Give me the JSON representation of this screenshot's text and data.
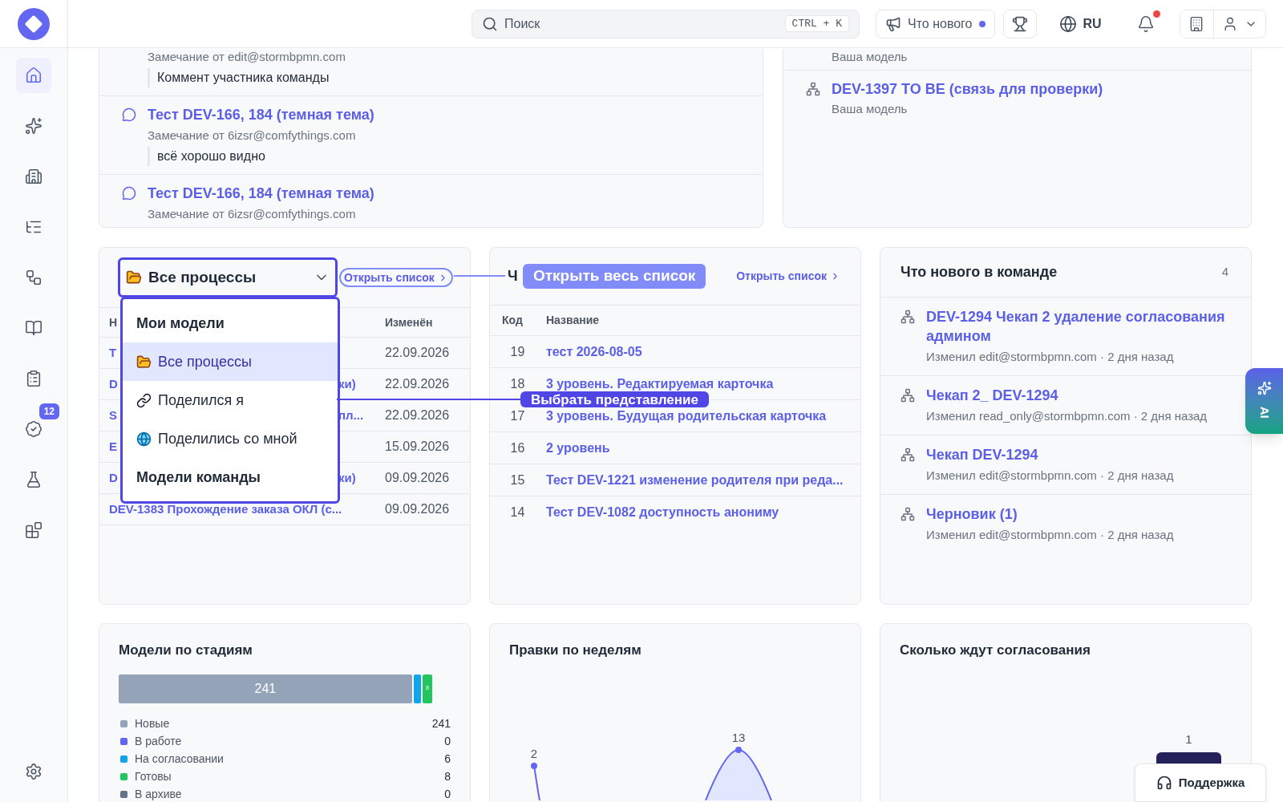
{
  "sidebar": {
    "nav": [
      {
        "selected": true
      },
      {
        "selected": false
      },
      {
        "selected": false
      },
      {
        "selected": false
      },
      {
        "selected": false
      },
      {
        "selected": false
      },
      {
        "selected": false
      },
      {
        "selected": false,
        "badge": "12"
      },
      {
        "selected": false
      },
      {
        "selected": false
      }
    ]
  },
  "header": {
    "search": {
      "placeholder": "Поиск",
      "shortcut": "CTRL + K"
    },
    "whats_new": {
      "label": "Что нового",
      "unread": true
    },
    "language": "RU",
    "notifications": {
      "unread": true
    }
  },
  "comments_card": {
    "items": [
      {
        "meta": "Замечание от edit@stormbpmn.com",
        "quote": "Коммент участника команды"
      },
      {
        "title": "Тест DEV-166, 184 (темная тема)",
        "meta": "Замечание от 6izsr@comfythings.com",
        "quote": "всё хорошо видно"
      },
      {
        "title": "Тест DEV-166, 184 (темная тема)",
        "meta": "Замечание от 6izsr@comfythings.com"
      }
    ]
  },
  "models_card": {
    "items": [
      {
        "subtitle": "Ваша модель"
      },
      {
        "title": "DEV-1397 TO BE (связь для проверки)",
        "subtitle": "Ваша модель"
      }
    ]
  },
  "processes_card": {
    "view_select": {
      "value": "Все процессы"
    },
    "open_link": "Открыть список",
    "columns": [
      "Н",
      "Изменён"
    ],
    "rows": [
      {
        "name": "Т",
        "modified": "22.09.2026"
      },
      {
        "name": "D",
        "name_tail": "ки)",
        "modified": "22.09.2026"
      },
      {
        "name": "S",
        "name_tail": "пл...",
        "modified": "22.09.2026"
      },
      {
        "name": "E",
        "modified": "15.09.2026"
      },
      {
        "name": "D",
        "name_tail": "ки)",
        "modified": "09.09.2026"
      },
      {
        "name": "DEV-1383 Прохождение заказа ОКЛ (с...",
        "modified": "09.09.2026"
      }
    ],
    "menu": [
      {
        "kind": "heading",
        "label": "Мои модели",
        "selected": false
      },
      {
        "kind": "option",
        "label": "Все процессы",
        "selected": true
      },
      {
        "kind": "option",
        "label": "Поделился я",
        "selected": false
      },
      {
        "kind": "option",
        "label": "Поделились со мной",
        "selected": false
      },
      {
        "kind": "heading",
        "label": "Модели команды",
        "selected": false
      }
    ]
  },
  "changes_card": {
    "title": "Ч",
    "open_link": "Открыть список",
    "columns": [
      "Код",
      "Название"
    ],
    "rows": [
      {
        "code": "19",
        "name": "тест 2026-08-05"
      },
      {
        "code": "18",
        "name": "3 уровень. Редактируемая карточка"
      },
      {
        "code": "17",
        "name": "3 уровень. Будущая родительская карточка"
      },
      {
        "code": "16",
        "name": "2 уровень"
      },
      {
        "code": "15",
        "name": "Тест DEV-1221 изменение родителя при реда..."
      },
      {
        "code": "14",
        "name": "Тест DEV-1082 доступность анониму"
      }
    ]
  },
  "team_news": {
    "title": "Что нового в команде",
    "count": "4",
    "items": [
      {
        "title": "DEV-1294 Чекап 2 удаление согласования админом",
        "meta": "Изменил edit@stormbpmn.com · 2 дня назад"
      },
      {
        "title": "Чекап 2_ DEV-1294",
        "meta": "Изменил read_only@stormbpmn.com · 2 дня назад"
      },
      {
        "title": "Чекап DEV-1294",
        "meta": "Изменил edit@stormbpmn.com · 2 дня назад"
      },
      {
        "title": "Черновик (1)",
        "meta": "Изменил edit@stormbpmn.com · 2 дня назад"
      }
    ]
  },
  "tour": {
    "hints": [
      "Открыть весь список",
      "Выбрать представление"
    ]
  },
  "stages_card": {
    "title": "Модели по стадиям",
    "stages": [
      {
        "name": "Новые",
        "count": "241",
        "color": "#94a3b8",
        "bar_label": "241"
      },
      {
        "name": "В работе",
        "count": "0",
        "color": "#6366f1"
      },
      {
        "name": "На согласовании",
        "count": "6",
        "color": "#0ea5e9"
      },
      {
        "name": "Готовы",
        "count": "8",
        "color": "#22c55e",
        "bar_label": "8"
      },
      {
        "name": "В архиве",
        "count": "0",
        "color": "#64748b"
      }
    ]
  },
  "weekly_edits": {
    "title": "Правки по неделям",
    "point_labels": [
      "2",
      "13"
    ]
  },
  "approval_wait": {
    "title": "Сколько ждут согласования",
    "bar_label": "1"
  },
  "support": {
    "label": "Поддержка"
  },
  "ai_tab": {
    "label": "AI"
  }
}
